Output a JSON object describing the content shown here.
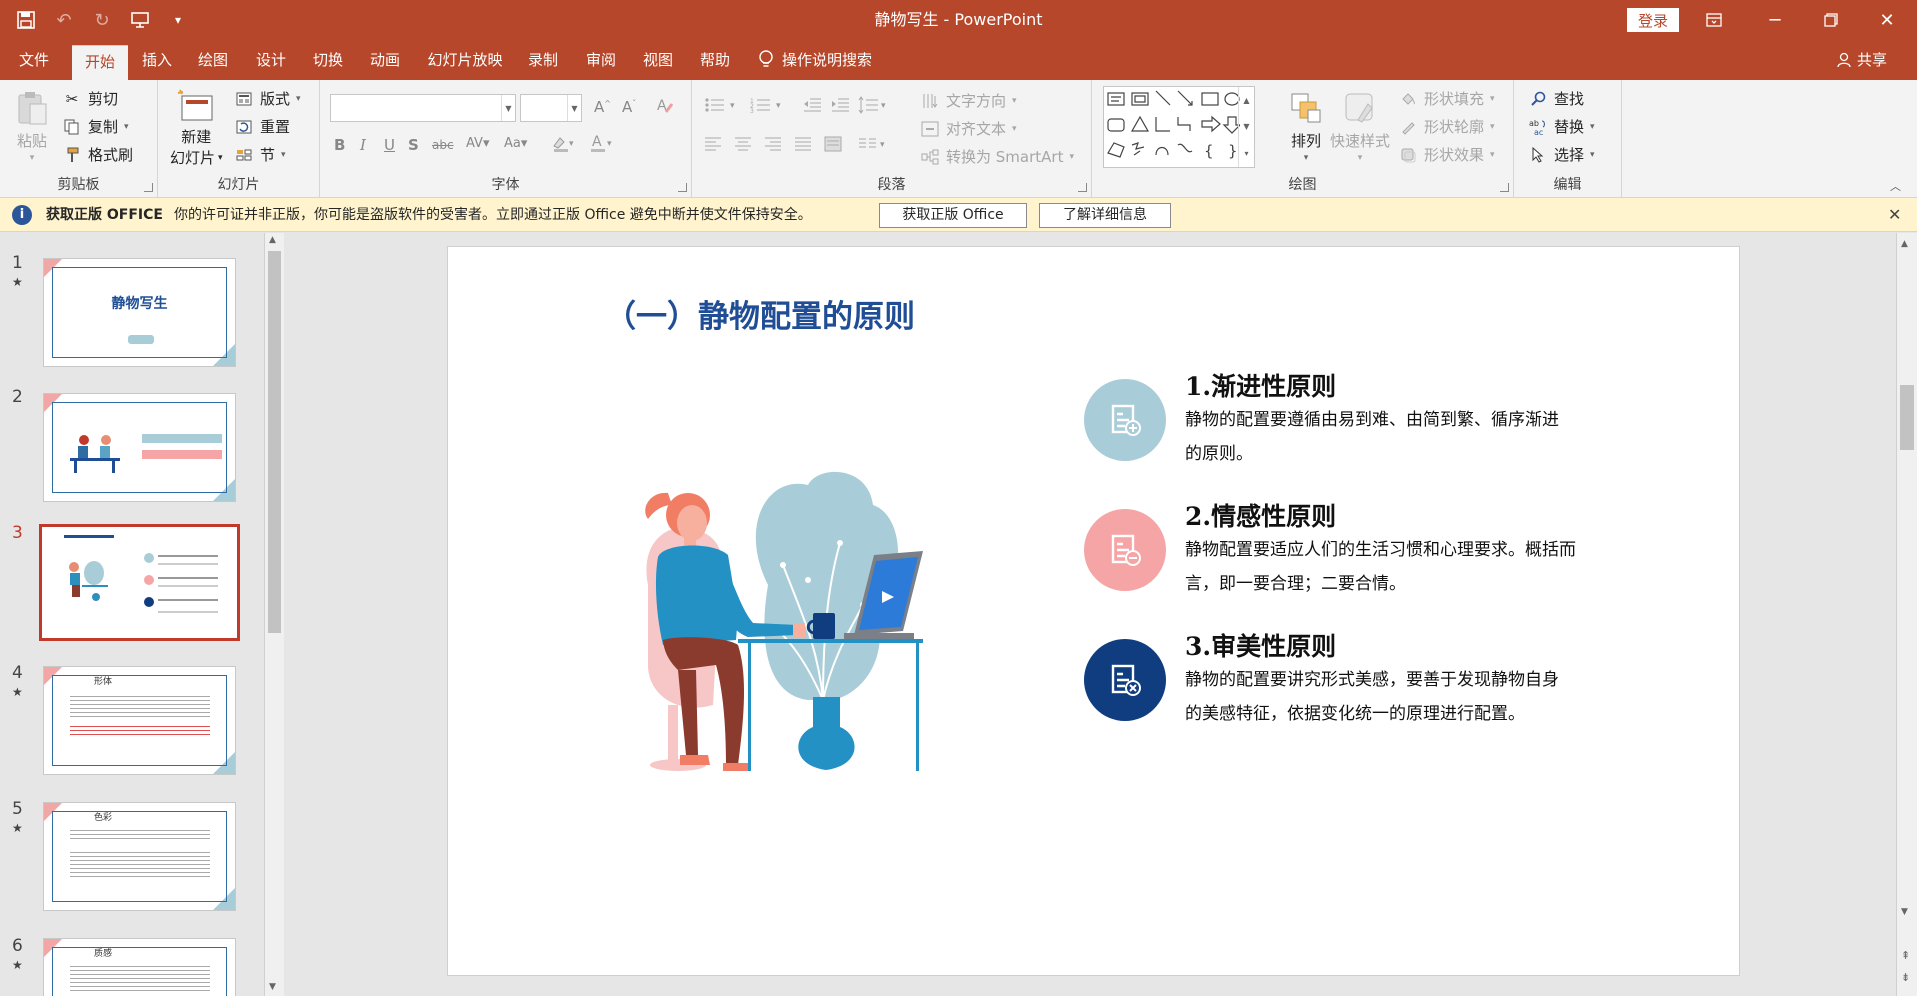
{
  "window": {
    "title": "静物写生  -  PowerPoint",
    "login_label": "登录"
  },
  "tabs": [
    "文件",
    "开始",
    "插入",
    "绘图",
    "设计",
    "切换",
    "动画",
    "幻灯片放映",
    "录制",
    "审阅",
    "视图",
    "帮助"
  ],
  "tell_me": "操作说明搜索",
  "share_label": "共享",
  "ribbon": {
    "clipboard": {
      "label": "剪贴板",
      "paste": "粘贴",
      "cut": "剪切",
      "copy": "复制",
      "format_painter": "格式刷"
    },
    "slides": {
      "label": "幻灯片",
      "new_slide_1": "新建",
      "new_slide_2": "幻灯片",
      "layout": "版式",
      "reset": "重置",
      "section": "节"
    },
    "font": {
      "label": "字体"
    },
    "paragraph": {
      "label": "段落",
      "text_direction": "文字方向",
      "align_text": "对齐文本",
      "smartart": "转换为 SmartArt"
    },
    "drawing": {
      "label": "绘图",
      "arrange": "排列",
      "quick_styles": "快速样式",
      "shape_fill": "形状填充",
      "shape_outline": "形状轮廓",
      "shape_effects": "形状效果"
    },
    "editing": {
      "label": "编辑",
      "find": "查找",
      "replace": "替换",
      "select": "选择"
    }
  },
  "message_bar": {
    "title": "获取正版 OFFICE",
    "text": "你的许可证并非正版，你可能是盗版软件的受害者。立即通过正版 Office 避免中断并使文件保持安全。",
    "btn_genuine": "获取正版 Office",
    "btn_learn": "了解详细信息"
  },
  "thumbnails": [
    {
      "num": "1",
      "title": "静物写生",
      "subtitle": ""
    },
    {
      "num": "2",
      "title": "",
      "subtitle": ""
    },
    {
      "num": "3",
      "title": "",
      "subtitle": ""
    },
    {
      "num": "4",
      "title": "形体",
      "subtitle": ""
    },
    {
      "num": "5",
      "title": "色彩",
      "subtitle": ""
    },
    {
      "num": "6",
      "title": "质感",
      "subtitle": ""
    }
  ],
  "slide": {
    "title": "（一）静物配置的原则",
    "principles": [
      {
        "title": "1.渐进性原则",
        "body": "静物的配置要遵循由易到难、由简到繁、循序渐进的原则。",
        "color": "#a9cdd8"
      },
      {
        "title": "2.情感性原则",
        "body": "静物配置要适应人们的生活习惯和心理要求。概括而言，即一要合理；二要合情。",
        "color": "#f5a5a5"
      },
      {
        "title": "3.审美性原则",
        "body": "静物的配置要讲究形式美感，要善于发现静物自身的美感特征，依据变化统一的原理进行配置。",
        "color": "#0f3d80"
      }
    ]
  },
  "colors": {
    "accent": "#b7472a",
    "title_blue": "#1f4e96"
  }
}
